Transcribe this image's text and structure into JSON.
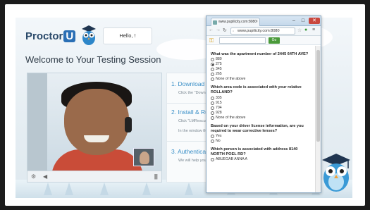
{
  "brand": {
    "name": "Proctor",
    "u": "U",
    "greeting": "Hello, !"
  },
  "welcome_title": "Welcome to Your Testing Session",
  "steps": [
    {
      "label": "1. Download",
      "sub": "Click the \"Down"
    },
    {
      "label": "2. Install & Run",
      "sub": "Click \"LMRescu",
      "sub2": "In the window th"
    },
    {
      "label": "3. Authenticat",
      "sub": "We will help you"
    }
  ],
  "browser": {
    "tab_title": "www.pupilicity.com:8080",
    "url": "www.pupilicity.com:8080",
    "go_label": "Go",
    "window_buttons": {
      "minimize": "–",
      "maximize": "□",
      "close": "✕"
    }
  },
  "questions": [
    {
      "text": "What was the apartment number of 2445 64TH AVE?",
      "options": [
        "880",
        "275",
        "345",
        "265",
        "None of the above"
      ],
      "selected": 1
    },
    {
      "text": "Which area code is associated with your relative ROLLAND?",
      "options": [
        "335",
        "915",
        "704",
        "928",
        "None of the above"
      ],
      "selected": -1
    },
    {
      "text": "Based on your driver license information, are you required to wear corrective lenses?",
      "options": [
        "Yes",
        "No"
      ],
      "selected": -1
    },
    {
      "text": "Which person is associated with address 8140 NORTH POEL RD?",
      "options": [
        "ABUEGAB ANNA A"
      ],
      "selected": -1
    }
  ],
  "icons": {
    "back": "←",
    "forward": "→",
    "reload": "↻",
    "star": "☆",
    "key": "⚿",
    "settings": "≡"
  }
}
